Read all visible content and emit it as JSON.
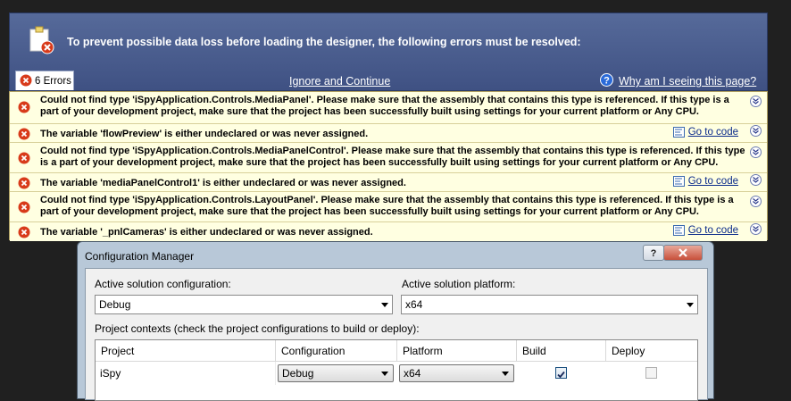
{
  "designer": {
    "header_title": "To prevent possible data loss before loading the designer, the following errors must be resolved:",
    "errors_tab": "6 Errors",
    "ignore_link": "Ignore and Continue",
    "why_link": "Why am I seeing this page?",
    "goto_label": "Go to code",
    "errors": [
      {
        "message": "Could not find type 'iSpyApplication.Controls.MediaPanel'. Please make sure that the assembly that contains this type is referenced. If this type is a part of your development project, make sure that the project has been successfully built using settings for your current platform or Any CPU.",
        "has_goto": false
      },
      {
        "message": "The variable 'flowPreview' is either undeclared or was never assigned.",
        "has_goto": true
      },
      {
        "message": "Could not find type 'iSpyApplication.Controls.MediaPanelControl'. Please make sure that the assembly that contains this type is referenced. If this type is a part of your development project, make sure that the project has been successfully built using settings for your current platform or Any CPU.",
        "has_goto": false
      },
      {
        "message": "The variable 'mediaPanelControl1' is either undeclared or was never assigned.",
        "has_goto": true
      },
      {
        "message": "Could not find type 'iSpyApplication.Controls.LayoutPanel'. Please make sure that the assembly that contains this type is referenced. If this type is a part of your development project, make sure that the project has been successfully built using settings for your current platform or Any CPU.",
        "has_goto": false
      },
      {
        "message": "The variable '_pnlCameras' is either undeclared or was never assigned.",
        "has_goto": true
      }
    ]
  },
  "config_manager": {
    "title": "Configuration Manager",
    "active_config_label": "Active solution configuration:",
    "active_config_value": "Debug",
    "active_platform_label": "Active solution platform:",
    "active_platform_value": "x64",
    "contexts_label": "Project contexts (check the project configurations to build or deploy):",
    "columns": [
      "Project",
      "Configuration",
      "Platform",
      "Build",
      "Deploy"
    ],
    "rows": [
      {
        "project": "iSpy",
        "configuration": "Debug",
        "platform": "x64",
        "build": true,
        "deploy": false
      }
    ]
  },
  "colors": {
    "header_bg": "#4a5d8f",
    "error_bg": "#ffffe1",
    "link": "#0a2a8a"
  }
}
